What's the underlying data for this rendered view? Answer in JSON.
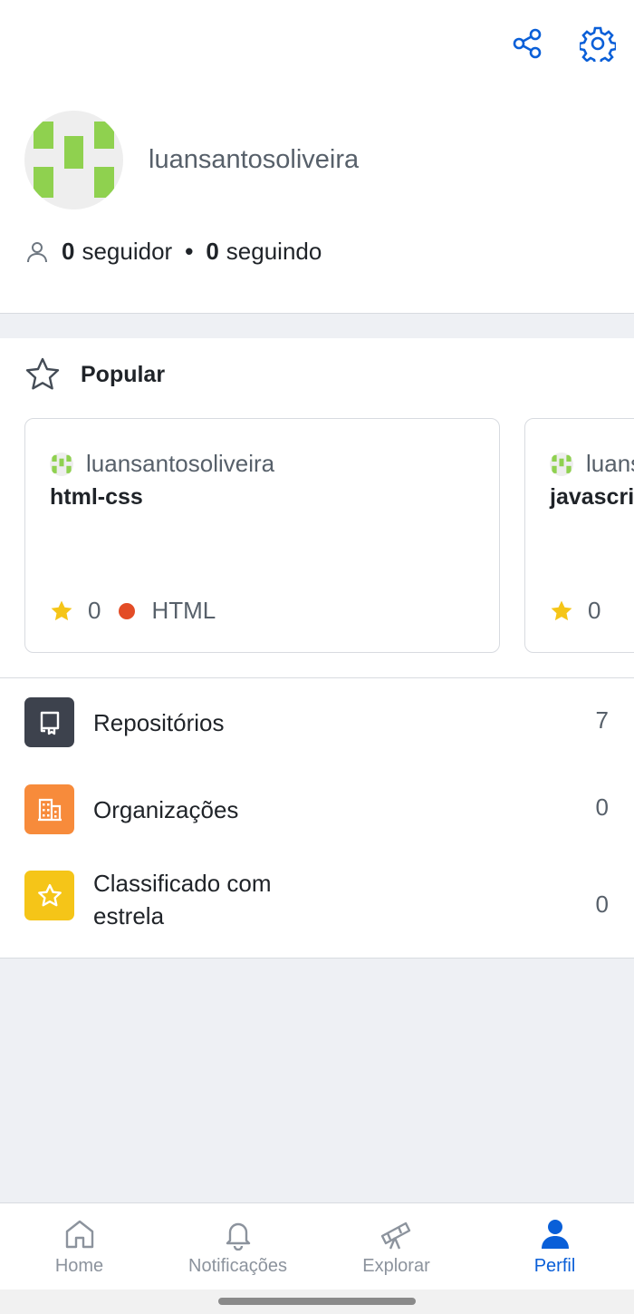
{
  "header": {
    "share_icon": "share-icon",
    "settings_icon": "gear-icon"
  },
  "profile": {
    "username": "luansantosoliveira",
    "followers_count": "0",
    "followers_label": "seguidor",
    "separator": "•",
    "following_count": "0",
    "following_label": "seguindo"
  },
  "popular": {
    "title": "Popular",
    "cards": [
      {
        "owner": "luansantosoliveira",
        "repo": "html-css",
        "stars": "0",
        "language": "HTML",
        "language_color": "#e34c26"
      },
      {
        "owner": "luansantosoliveira",
        "repo": "javascript",
        "stars": "0"
      }
    ]
  },
  "menu": {
    "items": [
      {
        "label": "Repositórios",
        "count": "7",
        "color": "#3d424d",
        "icon": "repo-icon"
      },
      {
        "label": "Organizações",
        "count": "0",
        "color": "#f78b3b",
        "icon": "organization-icon"
      },
      {
        "label": "Classificado com estrela",
        "count": "0",
        "color": "#f5c518",
        "icon": "star-icon"
      }
    ]
  },
  "bottom_nav": {
    "items": [
      {
        "label": "Home",
        "icon": "home-icon",
        "active": false
      },
      {
        "label": "Notificações",
        "icon": "bell-icon",
        "active": false
      },
      {
        "label": "Explorar",
        "icon": "telescope-icon",
        "active": false
      },
      {
        "label": "Perfil",
        "icon": "person-icon",
        "active": true
      }
    ]
  },
  "colors": {
    "accent": "#0a5fd8",
    "avatar_green": "#8fd14f",
    "star_yellow": "#f5c518"
  }
}
